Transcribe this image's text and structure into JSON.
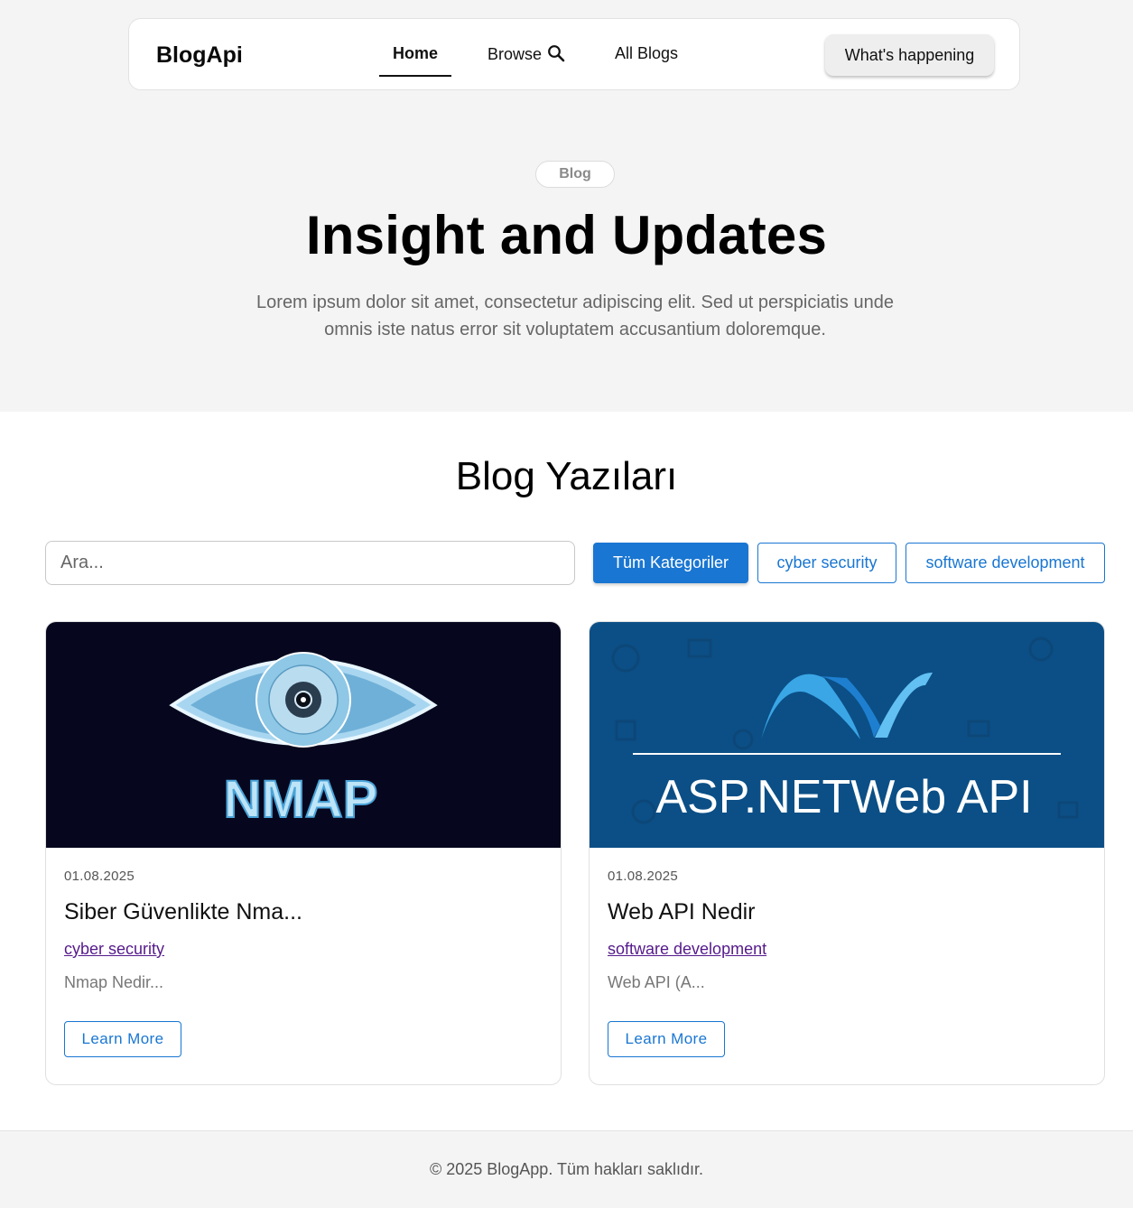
{
  "nav": {
    "brand": "BlogApi",
    "links": [
      {
        "label": "Home",
        "active": true
      },
      {
        "label": "Browse"
      },
      {
        "label": "All Blogs"
      }
    ],
    "cta_label": "What's happening"
  },
  "hero": {
    "badge": "Blog",
    "title": "Insight and Updates",
    "subtitle": "Lorem ipsum dolor sit amet, consectetur adipiscing elit. Sed ut perspiciatis unde omnis iste natus error sit voluptatem accusantium doloremque."
  },
  "blog": {
    "section_title": "Blog Yazıları",
    "search_placeholder": "Ara...",
    "categories": [
      {
        "label": "Tüm Kategoriler",
        "active": true
      },
      {
        "label": "cyber security"
      },
      {
        "label": "software development"
      }
    ],
    "posts": [
      {
        "date": "01.08.2025",
        "title": "Siber Güvenlikte Nma...",
        "category": "cyber security",
        "excerpt": "Nmap Nedir...",
        "button": "Learn More",
        "image_text": "NMAP"
      },
      {
        "date": "01.08.2025",
        "title": "Web API Nedir",
        "category": "software development",
        "excerpt": "Web API (A...",
        "button": "Learn More",
        "image_text": "ASP.NETWeb API"
      }
    ]
  },
  "footer": {
    "text": "© 2025 BlogApp. Tüm hakları saklıdır."
  },
  "colors": {
    "accent": "#1976d2",
    "link_visited": "#551a8b",
    "band": "#f4f4f4"
  }
}
